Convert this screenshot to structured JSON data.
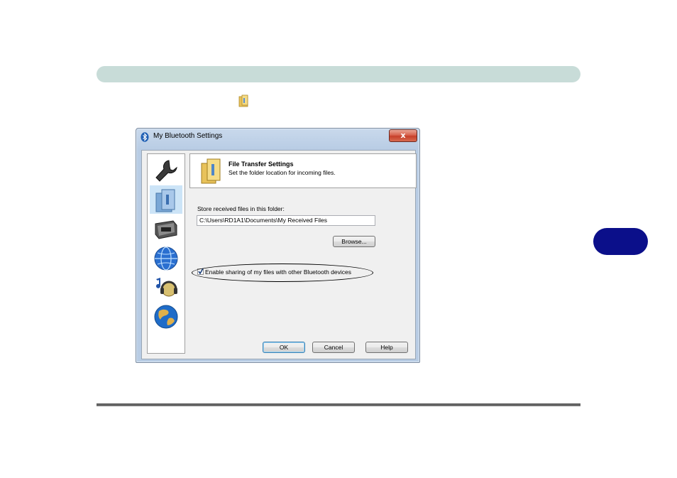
{
  "window": {
    "title": "My Bluetooth Settings",
    "close_label": "x"
  },
  "sidebar": {
    "items": [
      {
        "icon": "wrench-icon"
      },
      {
        "icon": "file-transfer-folder-icon",
        "selected": true
      },
      {
        "icon": "serial-port-icon"
      },
      {
        "icon": "network-globe-icon"
      },
      {
        "icon": "audio-headphones-icon"
      },
      {
        "icon": "earth-globe-icon"
      }
    ]
  },
  "banner": {
    "title": "File Transfer Settings",
    "subtitle": "Set the folder location for incoming files."
  },
  "form": {
    "store_label": "Store received files in this folder:",
    "path_value": "C:\\Users\\RD1A1\\Documents\\My Received Files",
    "browse_label": "Browse...",
    "share_label": "Enable sharing of my files with other Bluetooth devices",
    "share_checked": true
  },
  "buttons": {
    "ok": "OK",
    "cancel": "Cancel",
    "help": "Help"
  },
  "colors": {
    "header_bar": "#c8dcd8",
    "chapter_tab": "#0b0f8a"
  }
}
